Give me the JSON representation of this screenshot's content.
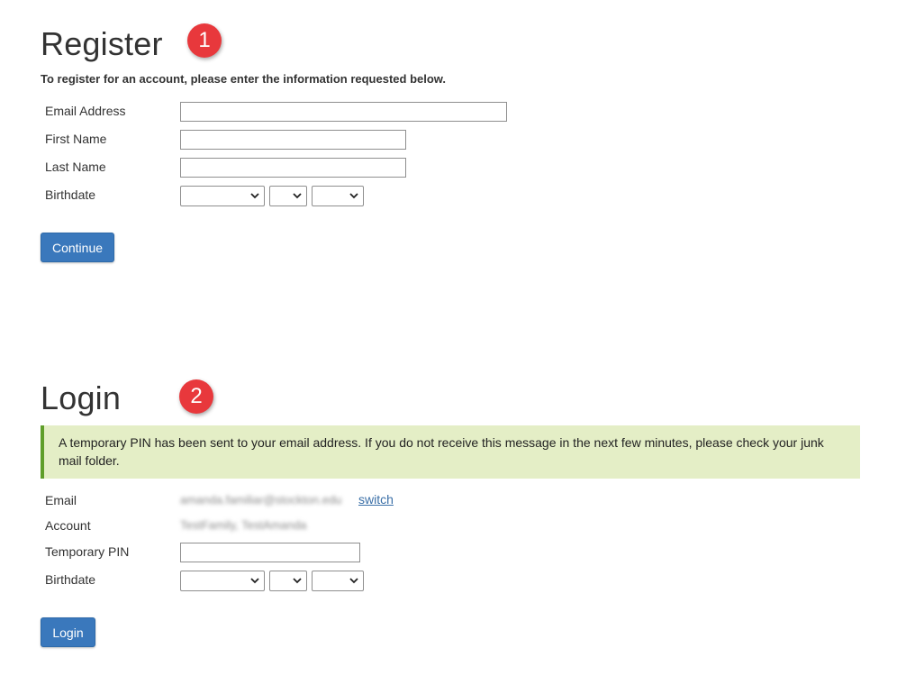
{
  "register": {
    "heading": "Register",
    "marker": "1",
    "intro": "To register for an account, please enter the information requested below.",
    "fields": {
      "email_label": "Email Address",
      "email_value": "",
      "first_name_label": "First Name",
      "first_name_value": "",
      "last_name_label": "Last Name",
      "last_name_value": "",
      "birthdate_label": "Birthdate"
    },
    "continue_label": "Continue"
  },
  "login": {
    "heading": "Login",
    "marker": "2",
    "alert": "A temporary PIN has been sent to your email address. If you do not receive this message in the next few minutes, please check your junk mail folder.",
    "email_label": "Email",
    "email_value": "amanda.familiar@stockton.edu",
    "switch_label": "switch",
    "account_label": "Account",
    "account_value": "TestFamily, TestAmanda",
    "pin_label": "Temporary PIN",
    "pin_value": "",
    "birthdate_label": "Birthdate",
    "login_label": "Login"
  },
  "colors": {
    "button": "#3a78bc",
    "marker": "#e8383c",
    "alert_bg": "#e4eec6",
    "alert_border": "#5f9e2a",
    "link": "#3a6fa7"
  }
}
